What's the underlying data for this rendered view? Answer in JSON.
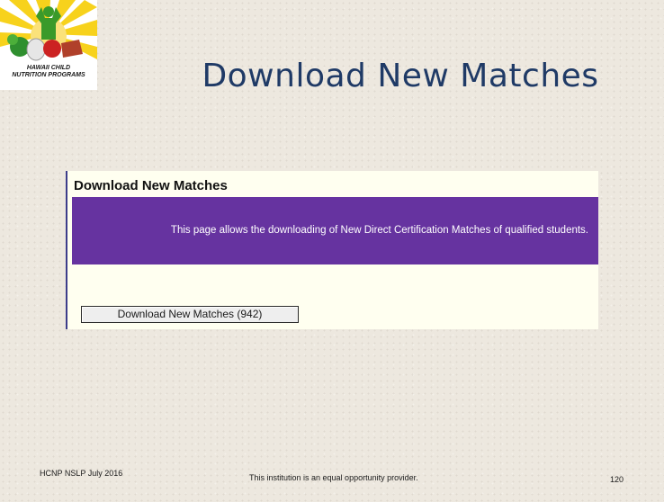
{
  "logo": {
    "line1": "HAWAII CHILD",
    "line2": "NUTRITION PROGRAMS",
    "icon": "hawaii-child-nutrition-logo-icon"
  },
  "slide": {
    "title": "Download New Matches"
  },
  "screenshot": {
    "heading": "Download New Matches",
    "banner_text": "This page allows the downloading of New Direct Certification Matches of qualified students.",
    "button_label": "Download New Matches (942)",
    "colors": {
      "banner": "#6633a0",
      "background": "#fffff0"
    }
  },
  "footer": {
    "left": "HCNP NSLP July 2016",
    "center": "This institution is an equal opportunity provider.",
    "page_number": "120"
  }
}
